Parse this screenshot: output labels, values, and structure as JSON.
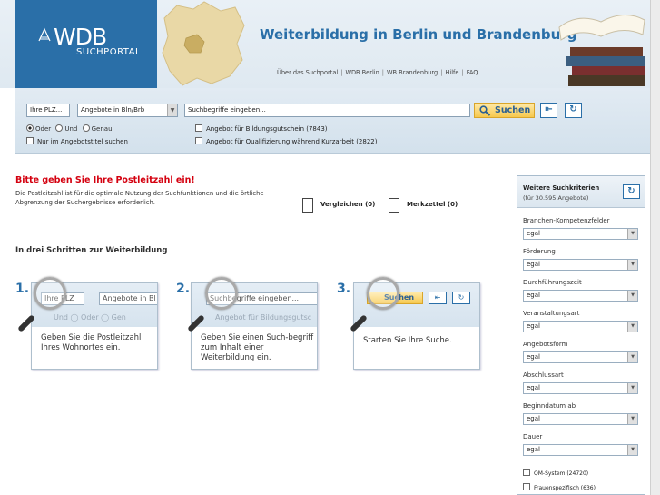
{
  "header": {
    "logo_text": "WDB",
    "logo_sub": "SUCHPORTAL",
    "site_title": "Weiterbildung in Berlin und Brandenburg",
    "nav": [
      "Über das Suchportal",
      "WDB Berlin",
      "WB Brandenburg",
      "Hilfe",
      "FAQ"
    ]
  },
  "search": {
    "plz_value": "Ihre PLZ...",
    "angebote_value": "Angebote in Bln/Brb",
    "query_placeholder": "Suchbegriffe eingeben...",
    "button_label": "Suchen",
    "radios": [
      {
        "label": "Oder",
        "checked": true
      },
      {
        "label": "Und",
        "checked": false
      },
      {
        "label": "Genau",
        "checked": false
      }
    ],
    "title_only_label": "Nur im Angebotstitel suchen",
    "bildungsgutschein_label": "Angebot für Bildungsgutschein (7843)",
    "kurzarbeit_label": "Angebot für Qualifizierung während Kurzarbeit (2822)"
  },
  "notice": {
    "title": "Bitte geben Sie Ihre Postleitzahl ein!",
    "text": "Die Postleitzahl ist für die optimale Nutzung der Suchfunktionen und die örtliche Abgrenzung der Suchergebnisse erforderlich."
  },
  "tools": {
    "compare_label": "Vergleichen (0)",
    "notepad_label": "Merkzettel (0)"
  },
  "steps": {
    "title": "In drei Schritten zur Weiterbildung",
    "items": [
      {
        "num": "1.",
        "field": "Ihre PLZ",
        "field2": "Angebote in Bl",
        "faded": "Und   ◯ Oder   ◯ Gen",
        "desc": "Geben Sie die Postleitzahl Ihres Wohnortes ein."
      },
      {
        "num": "2.",
        "field": "Suchbegriffe eingeben...",
        "faded": "Angebot für Bildungsgutsc",
        "desc": "Geben Sie einen Such-begriff zum Inhalt einer Weiterbildung ein."
      },
      {
        "num": "3.",
        "field": "Suchen",
        "desc": "Starten Sie Ihre Suche."
      }
    ]
  },
  "sidebar": {
    "title": "Weitere Suchkriterien",
    "subtitle": "(für 30.595 Angebote)",
    "criteria": [
      {
        "label": "Branchen-Kompetenzfelder",
        "value": "egal"
      },
      {
        "label": "Förderung",
        "value": "egal"
      },
      {
        "label": "Durchführungszeit",
        "value": "egal"
      },
      {
        "label": "Veranstaltungsart",
        "value": "egal"
      },
      {
        "label": "Angebotsform",
        "value": "egal"
      },
      {
        "label": "Abschlussart",
        "value": "egal"
      },
      {
        "label": "Beginndatum ab",
        "value": "egal"
      },
      {
        "label": "Dauer",
        "value": "egal"
      }
    ],
    "checks": [
      "QM-System (24720)",
      "Frauenspezifisch (636)"
    ]
  },
  "colors": {
    "brand_blue": "#2a6fa8",
    "warn_red": "#d4000f",
    "button_yellow": "#f6c84e"
  }
}
